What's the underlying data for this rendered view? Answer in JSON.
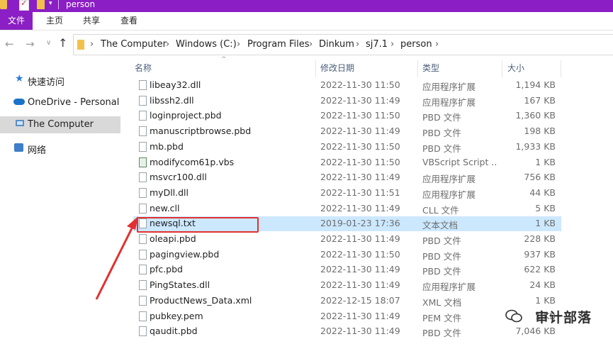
{
  "window": {
    "title": "person",
    "accent_color": "#8b1ec4"
  },
  "ribbon": {
    "tabs": [
      "文件",
      "主页",
      "共享",
      "查看"
    ]
  },
  "address_bar": {
    "breadcrumbs": [
      "The Computer",
      "Windows  (C:)",
      "Program Files",
      "Dinkum",
      "sj7.1",
      "person"
    ]
  },
  "sidebar": {
    "items": [
      {
        "label": "快速访问",
        "icon": "star-icon"
      },
      {
        "label": "OneDrive - Personal",
        "icon": "cloud-icon"
      },
      {
        "label": "The Computer",
        "icon": "computer-icon",
        "selected": true
      },
      {
        "label": "网络",
        "icon": "network-icon"
      }
    ]
  },
  "file_list": {
    "columns": [
      "名称",
      "修改日期",
      "类型",
      "大小"
    ],
    "rows": [
      {
        "name": "libeay32.dll",
        "date": "2022-11-30 11:50",
        "type": "应用程序扩展",
        "size": "1,194 KB"
      },
      {
        "name": "libssh2.dll",
        "date": "2022-11-30 11:49",
        "type": "应用程序扩展",
        "size": "167 KB"
      },
      {
        "name": "loginproject.pbd",
        "date": "2022-11-30 11:50",
        "type": "PBD 文件",
        "size": "1,360 KB"
      },
      {
        "name": "manuscriptbrowse.pbd",
        "date": "2022-11-30 11:49",
        "type": "PBD 文件",
        "size": "198 KB"
      },
      {
        "name": "mb.pbd",
        "date": "2022-11-30 11:50",
        "type": "PBD 文件",
        "size": "1,933 KB"
      },
      {
        "name": "modifycom61p.vbs",
        "date": "2022-11-30 11:50",
        "type": "VBScript Script ...",
        "size": "1 KB"
      },
      {
        "name": "msvcr100.dll",
        "date": "2022-11-30 11:49",
        "type": "应用程序扩展",
        "size": "756 KB"
      },
      {
        "name": "myDll.dll",
        "date": "2022-11-30 11:51",
        "type": "应用程序扩展",
        "size": "44 KB"
      },
      {
        "name": "new.cll",
        "date": "2022-11-30 11:49",
        "type": "CLL 文件",
        "size": "5 KB"
      },
      {
        "name": "newsql.txt",
        "date": "2019-01-23 17:36",
        "type": "文本文档",
        "size": "1 KB",
        "selected": true
      },
      {
        "name": "oleapi.pbd",
        "date": "2022-11-30 11:49",
        "type": "PBD 文件",
        "size": "228 KB"
      },
      {
        "name": "pagingview.pbd",
        "date": "2022-11-30 11:50",
        "type": "PBD 文件",
        "size": "937 KB"
      },
      {
        "name": "pfc.pbd",
        "date": "2022-11-30 11:49",
        "type": "PBD 文件",
        "size": "622 KB"
      },
      {
        "name": "PingStates.dll",
        "date": "2022-11-30 11:49",
        "type": "应用程序扩展",
        "size": "24 KB"
      },
      {
        "name": "ProductNews_Data.xml",
        "date": "2022-12-15 18:07",
        "type": "XML 文档",
        "size": "1 KB"
      },
      {
        "name": "pubkey.pem",
        "date": "2022-11-30 11:49",
        "type": "PEM 文件",
        "size": "1 KB"
      },
      {
        "name": "qaudit.pbd",
        "date": "2022-11-30 11:49",
        "type": "PBD 文件",
        "size": "7,046 KB"
      }
    ]
  },
  "annotation": {
    "highlight_color": "#e23030"
  },
  "watermark": {
    "text": "审计部落"
  }
}
